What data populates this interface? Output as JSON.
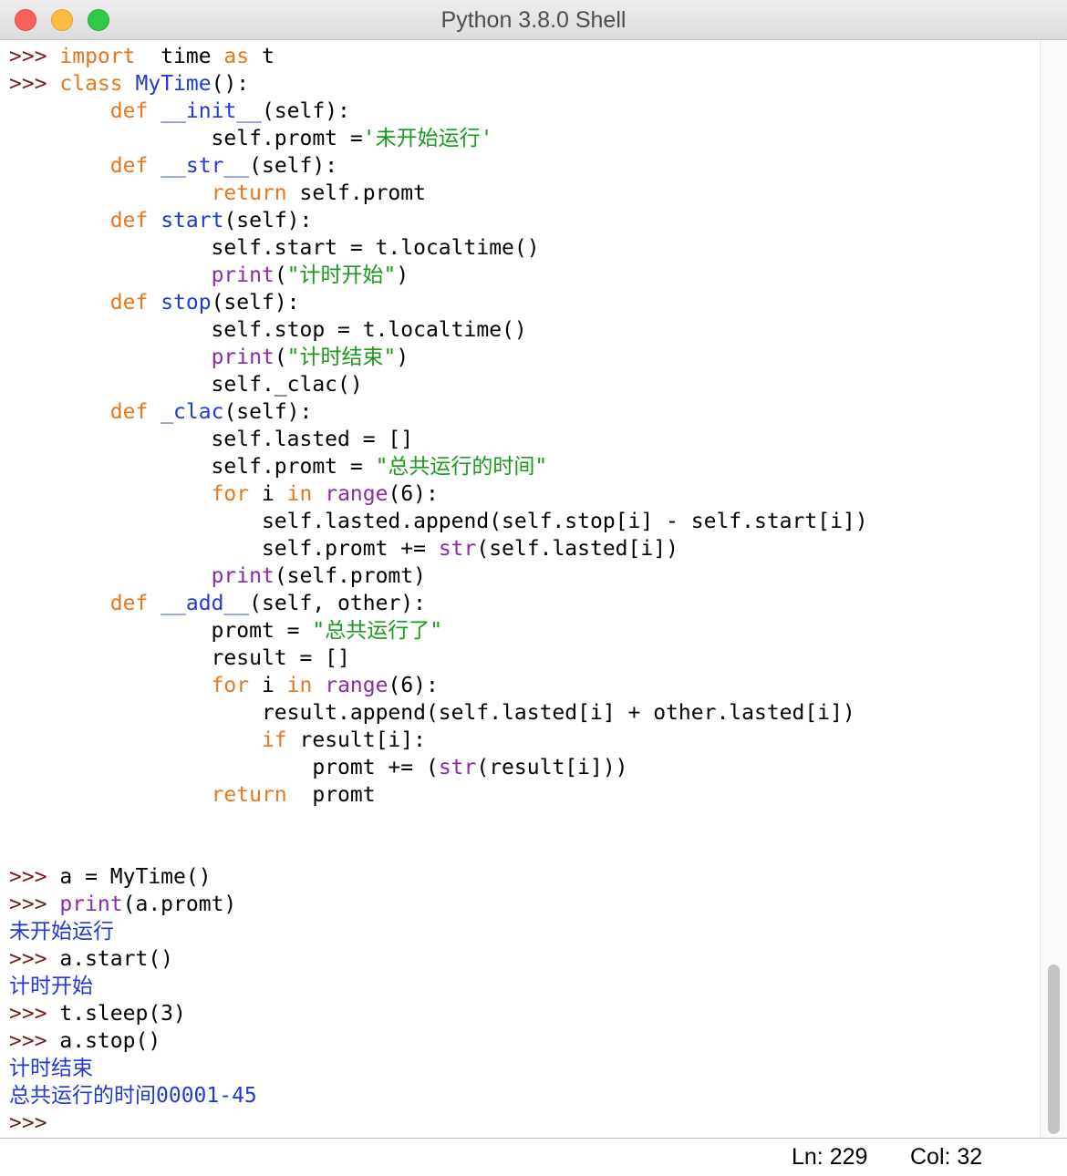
{
  "window": {
    "title": "Python 3.8.0 Shell"
  },
  "shell": {
    "prompt": ">>>",
    "lines": [
      [
        {
          "t": ">>> ",
          "c": "prompt"
        },
        {
          "t": "import",
          "c": "kw"
        },
        {
          "t": "  time "
        },
        {
          "t": "as",
          "c": "kw"
        },
        {
          "t": " t"
        }
      ],
      [
        {
          "t": ">>> ",
          "c": "prompt"
        },
        {
          "t": "class",
          "c": "kw"
        },
        {
          "t": " "
        },
        {
          "t": "MyTime",
          "c": "def"
        },
        {
          "t": "():"
        }
      ],
      [
        {
          "t": "        "
        },
        {
          "t": "def",
          "c": "kw"
        },
        {
          "t": " "
        },
        {
          "t": "__init__",
          "c": "def"
        },
        {
          "t": "(self):"
        }
      ],
      [
        {
          "t": "                self.promt ="
        },
        {
          "t": "'未开始运行'",
          "c": "str"
        }
      ],
      [
        {
          "t": "        "
        },
        {
          "t": "def",
          "c": "kw"
        },
        {
          "t": " "
        },
        {
          "t": "__str__",
          "c": "def"
        },
        {
          "t": "(self):"
        }
      ],
      [
        {
          "t": "                "
        },
        {
          "t": "return",
          "c": "kw"
        },
        {
          "t": " self.promt"
        }
      ],
      [
        {
          "t": "        "
        },
        {
          "t": "def",
          "c": "kw"
        },
        {
          "t": " "
        },
        {
          "t": "start",
          "c": "def"
        },
        {
          "t": "(self):"
        }
      ],
      [
        {
          "t": "                self.start = t.localtime()"
        }
      ],
      [
        {
          "t": "                "
        },
        {
          "t": "print",
          "c": "bi"
        },
        {
          "t": "("
        },
        {
          "t": "\"计时开始\"",
          "c": "str"
        },
        {
          "t": ")"
        }
      ],
      [
        {
          "t": "        "
        },
        {
          "t": "def",
          "c": "kw"
        },
        {
          "t": " "
        },
        {
          "t": "stop",
          "c": "def"
        },
        {
          "t": "(self):"
        }
      ],
      [
        {
          "t": "                self.stop = t.localtime()"
        }
      ],
      [
        {
          "t": "                "
        },
        {
          "t": "print",
          "c": "bi"
        },
        {
          "t": "("
        },
        {
          "t": "\"计时结束\"",
          "c": "str"
        },
        {
          "t": ")"
        }
      ],
      [
        {
          "t": "                self._clac()"
        }
      ],
      [
        {
          "t": "        "
        },
        {
          "t": "def",
          "c": "kw"
        },
        {
          "t": " "
        },
        {
          "t": "_clac",
          "c": "def"
        },
        {
          "t": "(self):"
        }
      ],
      [
        {
          "t": "                self.lasted = []"
        }
      ],
      [
        {
          "t": "                self.promt = "
        },
        {
          "t": "\"总共运行的时间\"",
          "c": "str"
        }
      ],
      [
        {
          "t": "                "
        },
        {
          "t": "for",
          "c": "kw"
        },
        {
          "t": " i "
        },
        {
          "t": "in",
          "c": "kw"
        },
        {
          "t": " "
        },
        {
          "t": "range",
          "c": "bi"
        },
        {
          "t": "(6):"
        }
      ],
      [
        {
          "t": "                    self.lasted.append(self.stop[i] - self.start[i])"
        }
      ],
      [
        {
          "t": "                    self.promt += "
        },
        {
          "t": "str",
          "c": "bi"
        },
        {
          "t": "(self.lasted[i])"
        }
      ],
      [
        {
          "t": "                "
        },
        {
          "t": "print",
          "c": "bi"
        },
        {
          "t": "(self.promt)"
        }
      ],
      [
        {
          "t": "        "
        },
        {
          "t": "def",
          "c": "kw"
        },
        {
          "t": " "
        },
        {
          "t": "__add__",
          "c": "def"
        },
        {
          "t": "(self, other):"
        }
      ],
      [
        {
          "t": "                promt = "
        },
        {
          "t": "\"总共运行了\"",
          "c": "str"
        }
      ],
      [
        {
          "t": "                result = []"
        }
      ],
      [
        {
          "t": "                "
        },
        {
          "t": "for",
          "c": "kw"
        },
        {
          "t": " i "
        },
        {
          "t": "in",
          "c": "kw"
        },
        {
          "t": " "
        },
        {
          "t": "range",
          "c": "bi"
        },
        {
          "t": "(6):"
        }
      ],
      [
        {
          "t": "                    result.append(self.lasted[i] + other.lasted[i])"
        }
      ],
      [
        {
          "t": "                    "
        },
        {
          "t": "if",
          "c": "kw"
        },
        {
          "t": " result[i]:"
        }
      ],
      [
        {
          "t": "                        promt += ("
        },
        {
          "t": "str",
          "c": "bi"
        },
        {
          "t": "(result[i]))"
        }
      ],
      [
        {
          "t": "                "
        },
        {
          "t": "return",
          "c": "kw"
        },
        {
          "t": "  promt"
        }
      ],
      [
        {
          "t": ""
        }
      ],
      [
        {
          "t": ""
        }
      ],
      [
        {
          "t": ">>> ",
          "c": "prompt"
        },
        {
          "t": "a = MyTime()"
        }
      ],
      [
        {
          "t": ">>> ",
          "c": "prompt"
        },
        {
          "t": "print",
          "c": "bi"
        },
        {
          "t": "(a.promt)"
        }
      ],
      [
        {
          "t": "未开始运行",
          "c": "out"
        }
      ],
      [
        {
          "t": ">>> ",
          "c": "prompt"
        },
        {
          "t": "a.start()"
        }
      ],
      [
        {
          "t": "计时开始",
          "c": "out"
        }
      ],
      [
        {
          "t": ">>> ",
          "c": "prompt"
        },
        {
          "t": "t.sleep(3)"
        }
      ],
      [
        {
          "t": ">>> ",
          "c": "prompt"
        },
        {
          "t": "a.stop()"
        }
      ],
      [
        {
          "t": "计时结束",
          "c": "out"
        }
      ],
      [
        {
          "t": "总共运行的时间00001-45",
          "c": "out"
        }
      ],
      [
        {
          "t": ">>>",
          "c": "prompt"
        }
      ]
    ]
  },
  "status": {
    "ln": "Ln: 229",
    "col": "Col: 32"
  },
  "colors": {
    "prompt": "#7a1b1b",
    "keyword": "#e8761c",
    "definition": "#1f3ad6",
    "builtin": "#8a2aa8",
    "string": "#1a9a1a",
    "output": "#1f3ad6"
  }
}
